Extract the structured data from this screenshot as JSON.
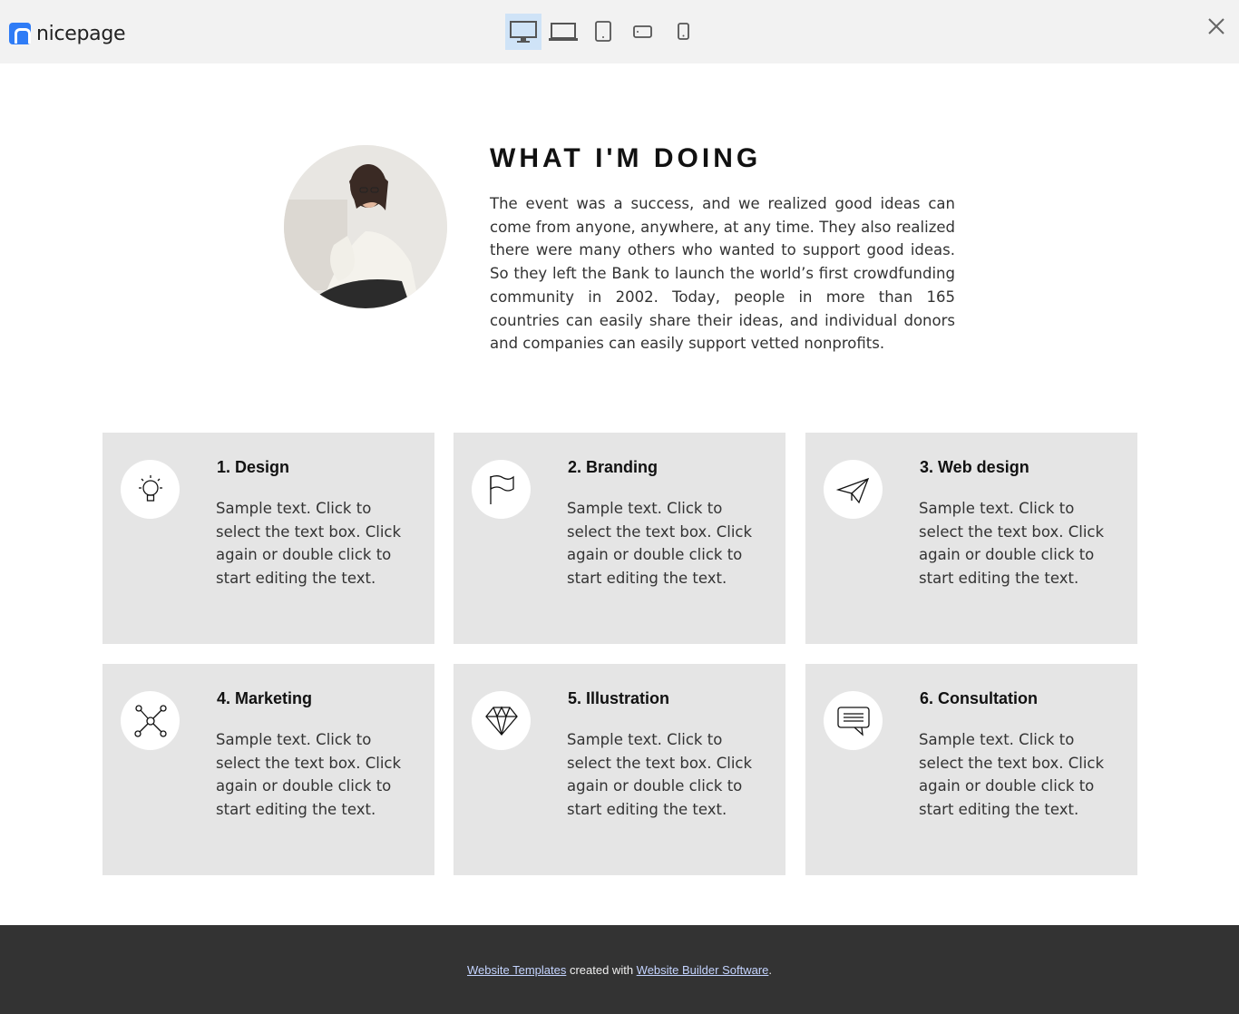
{
  "app": {
    "logo_text": "nicepage"
  },
  "toolbar": {
    "devices": [
      {
        "icon": "desktop-icon",
        "active": true
      },
      {
        "icon": "laptop-icon",
        "active": false
      },
      {
        "icon": "tablet-icon",
        "active": false
      },
      {
        "icon": "tablet-landscape-icon",
        "active": false
      },
      {
        "icon": "phone-icon",
        "active": false
      }
    ],
    "close_icon": "close-icon"
  },
  "about": {
    "title": "WHAT I'M DOING",
    "text": "The event was a success, and we realized good ideas can come from anyone, anywhere, at any time. They also realized there were many others who wanted to support good ideas. So they left the Bank to launch the world’s first crowdfunding community in 2002. Today, people in more than 165 countries can easily share their ideas, and individual donors and companies can easily support vetted nonprofits."
  },
  "services": [
    {
      "title": "1. Design",
      "text": "Sample text. Click to select the text box. Click again or double click to start editing the text.",
      "icon": "lightbulb-icon"
    },
    {
      "title": "2. Branding",
      "text": "Sample text. Click to select the text box. Click again or double click to start editing the text.",
      "icon": "flag-icon"
    },
    {
      "title": "3. Web design",
      "text": "Sample text. Click to select the text box. Click again or double click to start editing the text.",
      "icon": "paper-plane-icon"
    },
    {
      "title": "4. Marketing",
      "text": "Sample text. Click to select the text box. Click again or double click to start editing the text.",
      "icon": "network-icon"
    },
    {
      "title": "5. Illustration",
      "text": "Sample text. Click to select the text box. Click again or double click to start editing the text.",
      "icon": "diamond-icon"
    },
    {
      "title": "6. Consultation",
      "text": "Sample text. Click to select the text box. Click again or double click to start editing the text.",
      "icon": "chat-icon"
    }
  ],
  "footer": {
    "link1": "Website Templates",
    "middle": " created with ",
    "link2": "Website Builder Software",
    "end": "."
  },
  "colors": {
    "topbar_bg": "#f2f2f2",
    "accent": "#2f7cf6",
    "active_device_bg": "#cfe3f7",
    "card_bg": "#e5e5e5",
    "footer_bg": "#333333",
    "footer_link": "#c4d4ff"
  }
}
